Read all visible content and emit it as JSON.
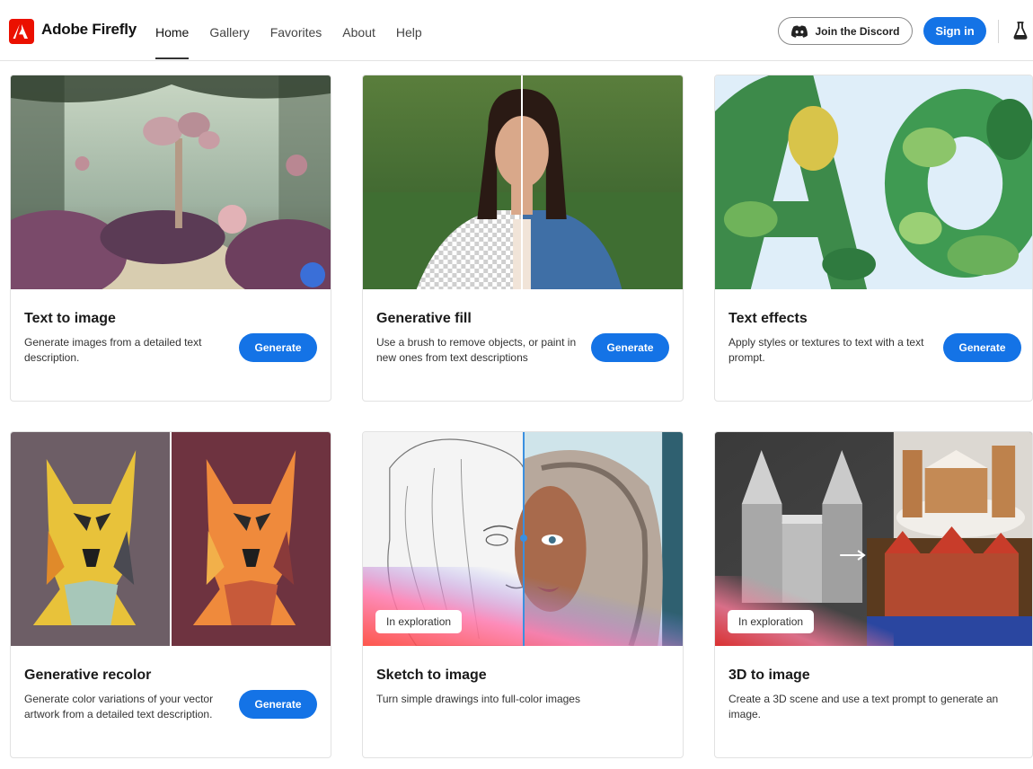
{
  "header": {
    "brand": "Adobe Firefly",
    "nav": [
      "Home",
      "Gallery",
      "Favorites",
      "About",
      "Help"
    ],
    "active_nav": "Home",
    "discord_label": "Join the Discord",
    "signin_label": "Sign in",
    "icons": {
      "logo": "adobe-logo-icon",
      "discord": "discord-icon",
      "labs": "beaker-icon"
    }
  },
  "colors": {
    "accent": "#1473e6",
    "brand_red": "#eb1000"
  },
  "cards": [
    {
      "title": "Text to image",
      "description": "Generate images from a detailed text description.",
      "button": "Generate"
    },
    {
      "title": "Generative fill",
      "description": "Use a brush to remove objects, or paint in new ones from text descriptions",
      "button": "Generate"
    },
    {
      "title": "Text effects",
      "description": "Apply styles or textures to text with a text prompt.",
      "button": "Generate"
    },
    {
      "title": "Generative recolor",
      "description": "Generate color variations of your vector artwork from a detailed text description.",
      "button": "Generate"
    },
    {
      "title": "Sketch to image",
      "description": "Turn simple drawings into full-color images",
      "badge": "In exploration"
    },
    {
      "title": "3D to image",
      "description": "Create a 3D scene and use a text prompt to generate an image.",
      "badge": "In exploration"
    }
  ]
}
